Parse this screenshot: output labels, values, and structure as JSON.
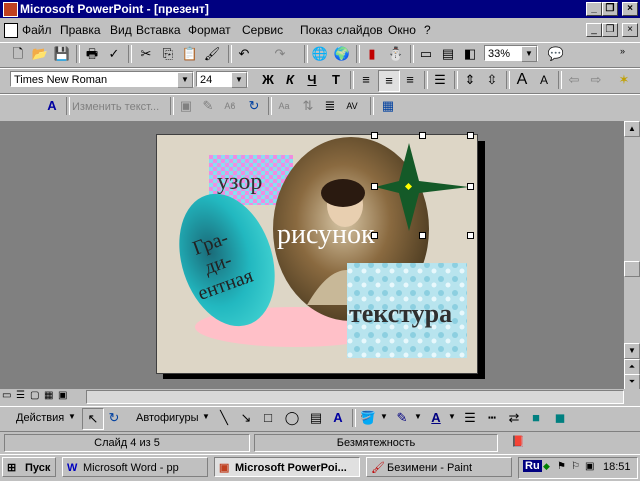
{
  "window": {
    "title": "Microsoft PowerPoint - [презент]"
  },
  "menu": [
    "Файл",
    "Правка",
    "Вид",
    "Вставка",
    "Формат",
    "Сервис",
    "Показ слайдов",
    "Окно",
    "?"
  ],
  "toolbar": {
    "zoom": "33%"
  },
  "format": {
    "font_name": "Times New Roman",
    "font_size": "24"
  },
  "outline": {
    "edit_text_label": "Изменить текст..."
  },
  "slide": {
    "label_pattern": "узор",
    "label_gradient": "Гра-\nди-\nентная",
    "label_picture": "рисунок",
    "label_texture": "текстура"
  },
  "drawing": {
    "actions_label": "Действия",
    "autoshapes_label": "Автофигуры"
  },
  "status": {
    "slide_info": "Слайд 4 из 5",
    "design": "Безмятежность"
  },
  "taskbar": {
    "start_label": "Пуск",
    "tasks": [
      "Microsoft Word - pp",
      "Microsoft PowerPoi...",
      "Безимени - Paint"
    ],
    "lang": "Ru",
    "time": "18:51"
  },
  "colors": {
    "title_bar": "#000080",
    "pattern": "#88e0f0",
    "gradient": "#22b8c0",
    "texture": "#b8e4ee",
    "star": "#145a28",
    "pink": "#ffc0c8"
  }
}
